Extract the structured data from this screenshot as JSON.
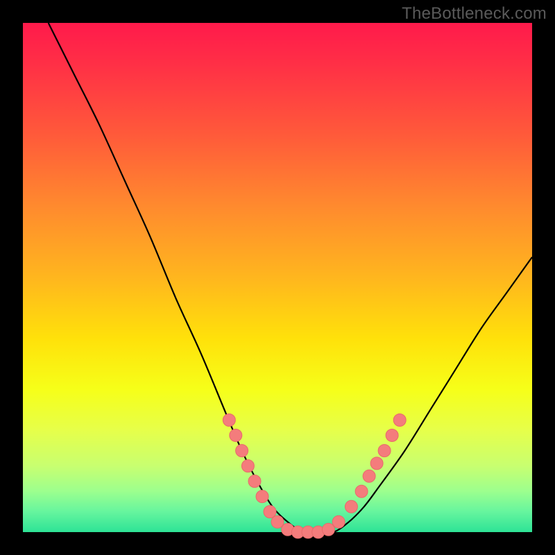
{
  "watermark": {
    "text": "TheBottleneck.com"
  },
  "colors": {
    "frame": "#000000",
    "curve": "#000000",
    "dot_fill": "#f47c7c",
    "dot_stroke": "#e86a6a"
  },
  "chart_data": {
    "type": "line",
    "title": "",
    "xlabel": "",
    "ylabel": "",
    "xlim": [
      0,
      100
    ],
    "ylim": [
      0,
      100
    ],
    "grid": false,
    "legend": false,
    "series": [
      {
        "name": "curve",
        "x": [
          5,
          10,
          15,
          20,
          25,
          30,
          35,
          40,
          43,
          46,
          49,
          52,
          55,
          58,
          61,
          64,
          67,
          70,
          75,
          80,
          85,
          90,
          95,
          100
        ],
        "y": [
          100,
          90,
          80,
          69,
          58,
          46,
          35,
          23,
          16,
          10,
          5,
          2,
          0,
          0,
          0,
          2,
          5,
          9,
          16,
          24,
          32,
          40,
          47,
          54
        ]
      }
    ],
    "dots": [
      {
        "x": 40.5,
        "y": 22
      },
      {
        "x": 41.8,
        "y": 19
      },
      {
        "x": 43.0,
        "y": 16
      },
      {
        "x": 44.2,
        "y": 13
      },
      {
        "x": 45.5,
        "y": 10
      },
      {
        "x": 47.0,
        "y": 7
      },
      {
        "x": 48.5,
        "y": 4
      },
      {
        "x": 50.0,
        "y": 2
      },
      {
        "x": 52.0,
        "y": 0.5
      },
      {
        "x": 54.0,
        "y": 0
      },
      {
        "x": 56.0,
        "y": 0
      },
      {
        "x": 58.0,
        "y": 0
      },
      {
        "x": 60.0,
        "y": 0.5
      },
      {
        "x": 62.0,
        "y": 2
      },
      {
        "x": 64.5,
        "y": 5
      },
      {
        "x": 66.5,
        "y": 8
      },
      {
        "x": 68.0,
        "y": 11
      },
      {
        "x": 69.5,
        "y": 13.5
      },
      {
        "x": 71.0,
        "y": 16
      },
      {
        "x": 72.5,
        "y": 19
      },
      {
        "x": 74.0,
        "y": 22
      }
    ]
  }
}
